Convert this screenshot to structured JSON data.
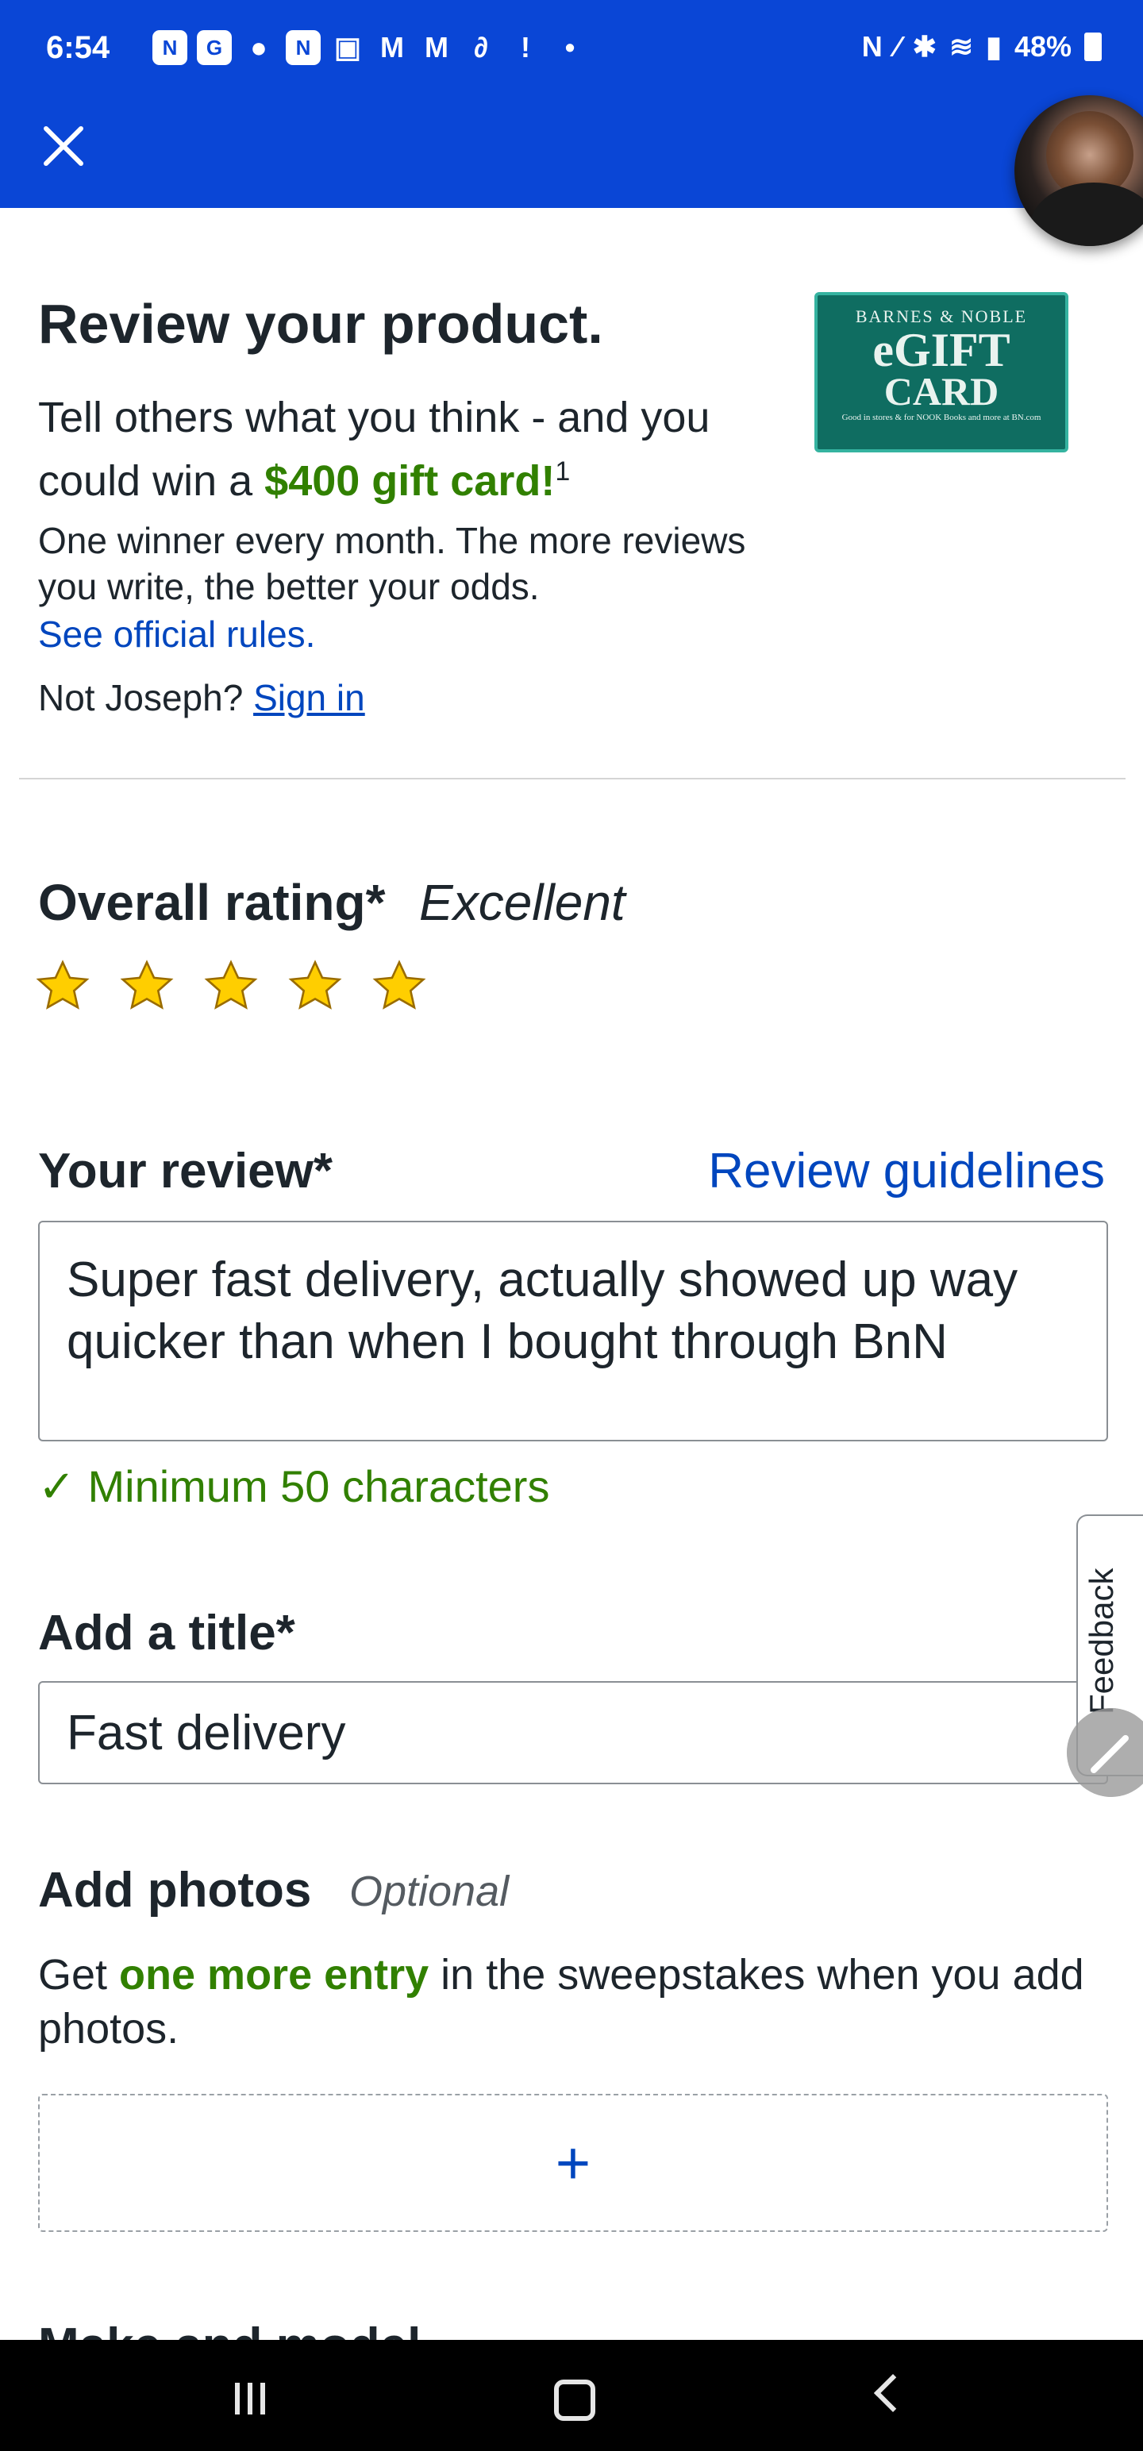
{
  "status_bar": {
    "time": "6:54",
    "battery": "48%"
  },
  "header": {
    "close_icon": "close-icon",
    "bg_color": "#0a46d6"
  },
  "intro": {
    "title": "Review your product.",
    "subtitle_pre": "Tell others what you think - and you could win a ",
    "subtitle_highlight": "$400 gift card!",
    "subtitle_sup": "1",
    "detail": "One winner every month. The more reviews you write, the better your odds.",
    "rules_link": "See official rules.",
    "not_user": "Not Joseph?",
    "sign_in": "Sign in"
  },
  "gift_card": {
    "brand": "BARNES & NOBLE",
    "line1": "eGIFT",
    "line2": "CARD",
    "fine_print": "Good in stores & for NOOK Books and more at BN.com"
  },
  "rating": {
    "label": "Overall rating*",
    "value": "Excellent",
    "stars": 5,
    "max_stars": 5
  },
  "review": {
    "label": "Your review*",
    "guidelines_link": "Review guidelines",
    "text": "Super fast delivery, actually showed up way quicker than when I bought through BnN",
    "validation": "✓ Minimum 50 characters"
  },
  "title_field": {
    "label": "Add a title*",
    "value": "Fast delivery"
  },
  "photos": {
    "label": "Add photos",
    "optional": "Optional",
    "desc_pre": "Get ",
    "desc_highlight": "one more entry",
    "desc_post": " in the sweepstakes when you add photos.",
    "add_symbol": "+"
  },
  "next_section": {
    "partial_heading": "Make and model"
  },
  "feedback": {
    "label": "Feedback"
  },
  "colors": {
    "brand_blue": "#0a46d6",
    "link_blue": "#0046be",
    "success_green": "#318000",
    "star_yellow": "#ffce00"
  }
}
